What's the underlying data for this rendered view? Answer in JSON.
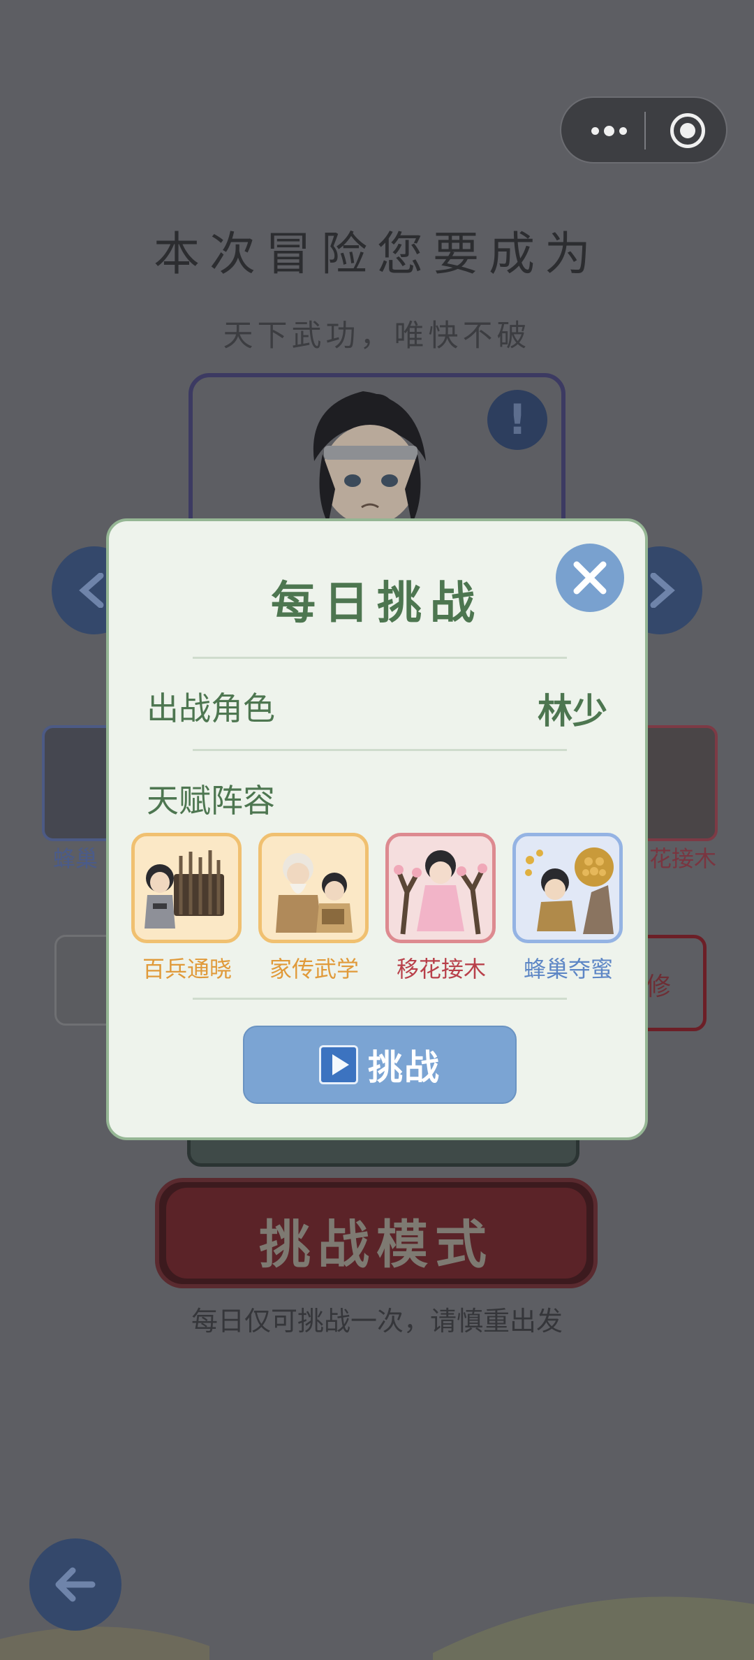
{
  "background": {
    "title": "本次冒险您要成为",
    "subtitle": "天下武功，唯快不破",
    "left_talent_label": "蜂巢",
    "right_talent_label": "花接木",
    "right_button_fragment": "修",
    "mode_button_label": "挑战模式",
    "mode_hint": "每日仅可挑战一次，请慎重出发"
  },
  "modal": {
    "title": "每日挑战",
    "character_label": "出战角色",
    "character_value": "林少",
    "talent_label": "天赋阵容",
    "talents": [
      {
        "name": "百兵通晓",
        "color": "#e09a3a",
        "border": "#f0c070"
      },
      {
        "name": "家传武学",
        "color": "#e09a3a",
        "border": "#f0c070"
      },
      {
        "name": "移花接木",
        "color": "#b8404a",
        "border": "#dd8a90"
      },
      {
        "name": "蜂巢夺蜜",
        "color": "#5d86c5",
        "border": "#94b3e3"
      }
    ],
    "challenge_label": "挑战"
  },
  "icons": {
    "close": "close-icon",
    "play": "play-icon",
    "back": "back-arrow-icon",
    "more": "more-dots-icon",
    "target": "target-icon"
  }
}
